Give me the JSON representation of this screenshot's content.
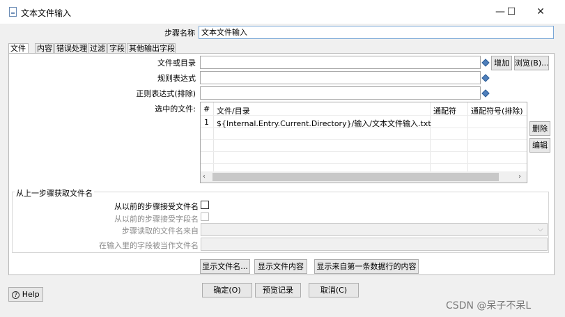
{
  "window": {
    "title": "文本文件输入",
    "minimize": "—",
    "maximize": "☐",
    "close": "✕"
  },
  "step": {
    "label": "步骤名称",
    "value": "文本文件输入"
  },
  "tabs": [
    {
      "label": "文件"
    },
    {
      "label": "内容"
    },
    {
      "label": "错误处理"
    },
    {
      "label": "过滤"
    },
    {
      "label": "字段"
    },
    {
      "label": "其他输出字段"
    }
  ],
  "file_tab": {
    "file_or_dir_label": "文件或目录",
    "regex_label": "规则表达式",
    "regex_exclude_label": "正则表达式(排除)",
    "add_button": "增加",
    "browse_button": "浏览(B)...",
    "selected_files_label": "选中的文件:",
    "delete_button": "删除",
    "edit_button": "编辑",
    "table": {
      "columns": [
        "#",
        "文件/目录",
        "通配符",
        "通配符号(排除)"
      ],
      "rows": [
        {
          "num": "1",
          "path": "${Internal.Entry.Current.Directory}/输入/文本文件输入.txt",
          "wildcard": "",
          "wildcard_exclude": ""
        }
      ]
    }
  },
  "from_prev": {
    "group_title": "从上一步骤获取文件名",
    "accept_filenames_label": "从以前的步骤接受文件名",
    "accept_fieldname_label": "从以前的步骤接受字段名",
    "step_read_from_label": "步骤读取的文件名来自",
    "field_as_filename_label": "在输入里的字段被当作文件名"
  },
  "bottom_buttons": {
    "show_filenames": "显示文件名...",
    "show_file_content": "显示文件内容",
    "show_first_row": "显示来自第一条数据行的内容",
    "ok": "确定(O)",
    "preview": "预览记录",
    "cancel": "取消(C)",
    "help": "Help",
    "help_glyph": "?"
  },
  "watermark": "CSDN @呆子不呆L"
}
